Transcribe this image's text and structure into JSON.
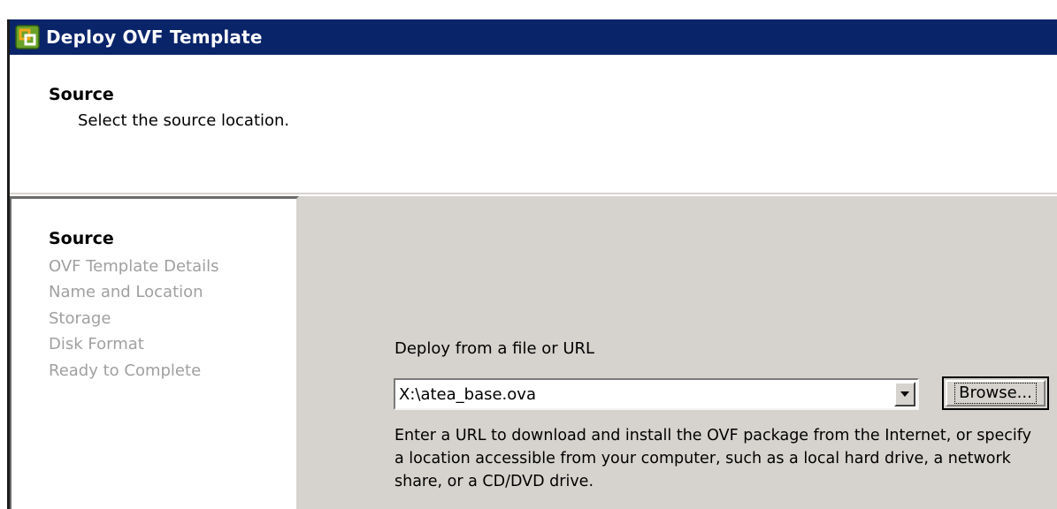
{
  "window": {
    "title": "Deploy OVF Template"
  },
  "header": {
    "title": "Source",
    "subtitle": "Select the source location."
  },
  "steps": [
    {
      "label": "Source",
      "active": true
    },
    {
      "label": "OVF Template Details",
      "active": false
    },
    {
      "label": "Name and Location",
      "active": false
    },
    {
      "label": "Storage",
      "active": false
    },
    {
      "label": "Disk Format",
      "active": false
    },
    {
      "label": "Ready to Complete",
      "active": false
    }
  ],
  "main": {
    "deploy_label": "Deploy from a file or URL",
    "source_value": "X:\\atea_base.ova",
    "browse_label": "Browse...",
    "help_text": "Enter a URL to download and install the OVF package from the Internet, or specify a location accessible from your computer, such as a local hard drive, a network share, or a CD/DVD drive."
  },
  "icons": {
    "app": "vsphere-app-icon",
    "dropdown": "chevron-down-icon"
  },
  "colors": {
    "titlebar": "#0a246a",
    "panel": "#d6d3ce",
    "inactive_step": "#a0a0a0"
  }
}
